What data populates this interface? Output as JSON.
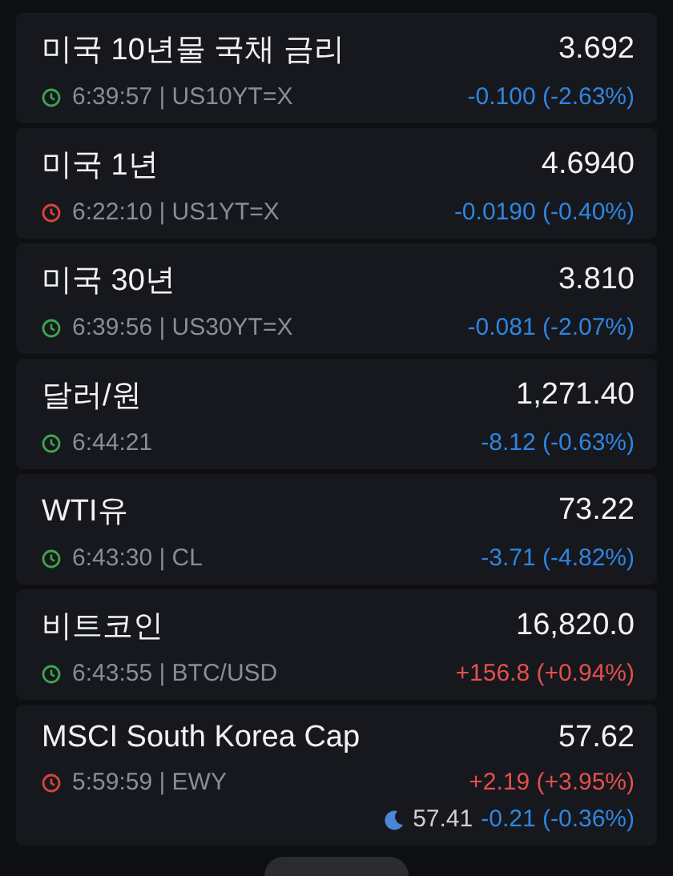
{
  "quotes": [
    {
      "name": "미국 10년물 국채 금리",
      "price": "3.692",
      "meta": "6:39:57 | US10YT=X",
      "live": true,
      "change": "-0.100 (-2.63%)",
      "rising": false
    },
    {
      "name": "미국 1년",
      "price": "4.6940",
      "meta": "6:22:10 | US1YT=X",
      "live": false,
      "change": "-0.0190 (-0.40%)",
      "rising": false
    },
    {
      "name": "미국 30년",
      "price": "3.810",
      "meta": "6:39:56 | US30YT=X",
      "live": true,
      "change": "-0.081 (-2.07%)",
      "rising": false
    },
    {
      "name": "달러/원",
      "price": "1,271.40",
      "meta": "6:44:21",
      "live": true,
      "change": "-8.12 (-0.63%)",
      "rising": false
    },
    {
      "name": "WTI유",
      "price": "73.22",
      "meta": "6:43:30 | CL",
      "live": true,
      "change": "-3.71 (-4.82%)",
      "rising": false
    },
    {
      "name": "비트코인",
      "price": "16,820.0",
      "meta": "6:43:55 | BTC/USD",
      "live": true,
      "change": "+156.8 (+0.94%)",
      "rising": true
    },
    {
      "name": "MSCI South Korea Cap",
      "price": "57.62",
      "meta": "5:59:59 | EWY",
      "live": false,
      "change": "+2.19 (+3.95%)",
      "rising": true,
      "after_hours": {
        "price": "57.41",
        "change": "-0.21 (-0.36%)",
        "rising": false
      }
    }
  ]
}
